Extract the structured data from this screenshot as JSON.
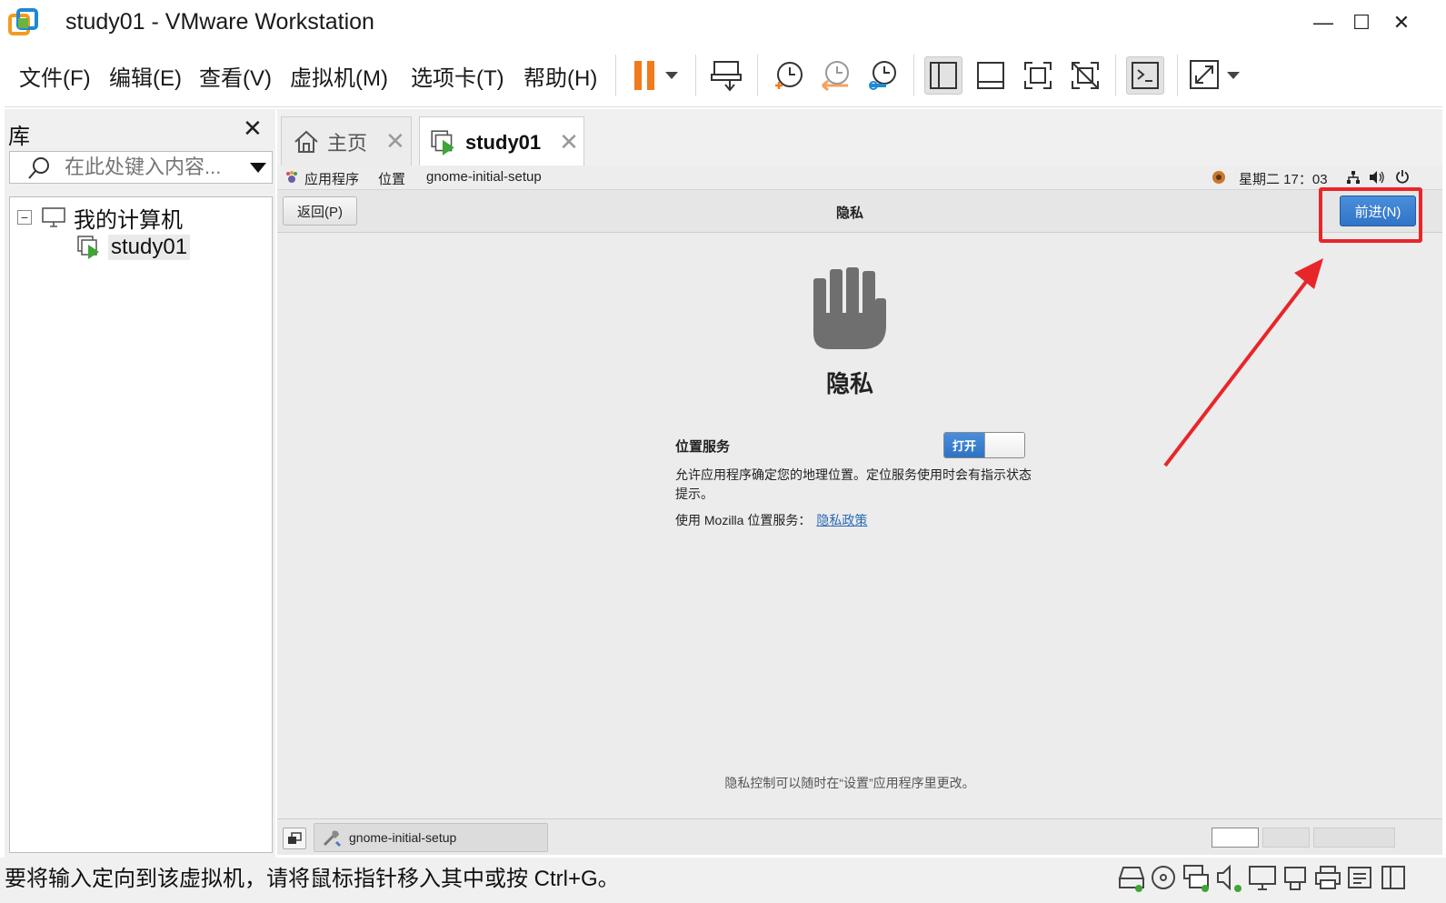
{
  "window": {
    "title": "study01 - VMware Workstation",
    "minimize": "—",
    "maximize": "☐",
    "close": "✕"
  },
  "menu": {
    "items": [
      "文件(F)",
      "编辑(E)",
      "查看(V)",
      "虚拟机(M)",
      "选项卡(T)",
      "帮助(H)"
    ]
  },
  "library": {
    "title": "库",
    "close": "✕",
    "search_placeholder": "在此处键入内容...",
    "tree": {
      "root": "我的计算机",
      "root_expander": "−",
      "vm": "study01"
    }
  },
  "tabs": [
    {
      "label": "主页",
      "close": "✕"
    },
    {
      "label": "study01",
      "close": "✕"
    }
  ],
  "guest": {
    "top_bar": {
      "applications": "应用程序",
      "places": "位置",
      "app_name": "gnome-initial-setup",
      "clock": "星期二 17：03"
    },
    "header": {
      "back": "返回(P)",
      "title": "隐私",
      "next": "前进(N)"
    },
    "page": {
      "title": "隐私",
      "location_label": "位置服务",
      "toggle_state": "打开",
      "toggle_on": true,
      "location_desc": "允许应用程序确定您的地理位置。定位服务使用时会有指示状态提示。",
      "mozilla_text": "使用  Mozilla 位置服务：",
      "policy_link": "隐私政策",
      "footer": "隐私控制可以随时在“设置”应用程序里更改。"
    },
    "taskbar": {
      "task": "gnome-initial-setup"
    }
  },
  "status": {
    "text": "要将输入定向到该虚拟机，请将鼠标指针移入其中或按 Ctrl+G。"
  },
  "colors": {
    "accent_blue": "#2f74c7",
    "highlight_red": "#e8262a",
    "vm_green": "#3fa535",
    "pause_orange": "#f07a1c"
  }
}
